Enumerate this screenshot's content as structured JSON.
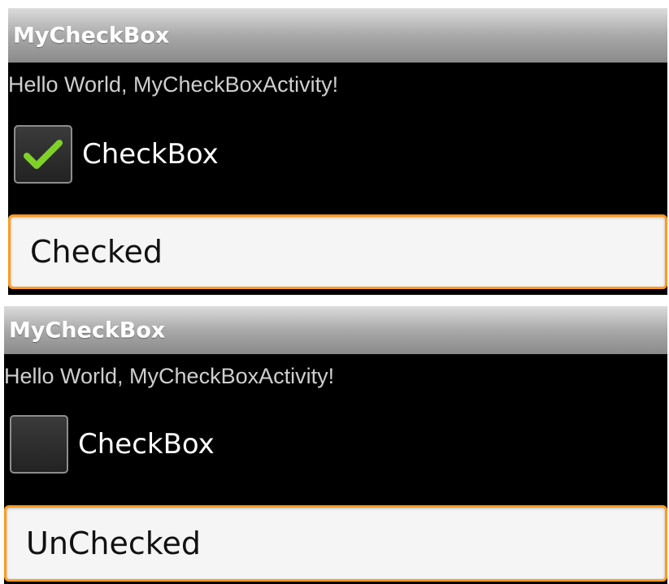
{
  "screens": [
    {
      "app_title": "MyCheckBox",
      "greeting": "Hello World, MyCheckBoxActivity!",
      "checkbox": {
        "label": "CheckBox",
        "checked": true,
        "check_icon": "checkmark-icon",
        "check_color": "#7fd128"
      },
      "status_text": "Checked"
    },
    {
      "app_title": "MyCheckBox",
      "greeting": "Hello World, MyCheckBoxActivity!",
      "checkbox": {
        "label": "CheckBox",
        "checked": false
      },
      "status_text": "UnChecked"
    }
  ],
  "colors": {
    "accent_orange": "#ff9a1f",
    "background": "#000000",
    "field_background": "#f5f5f5"
  }
}
